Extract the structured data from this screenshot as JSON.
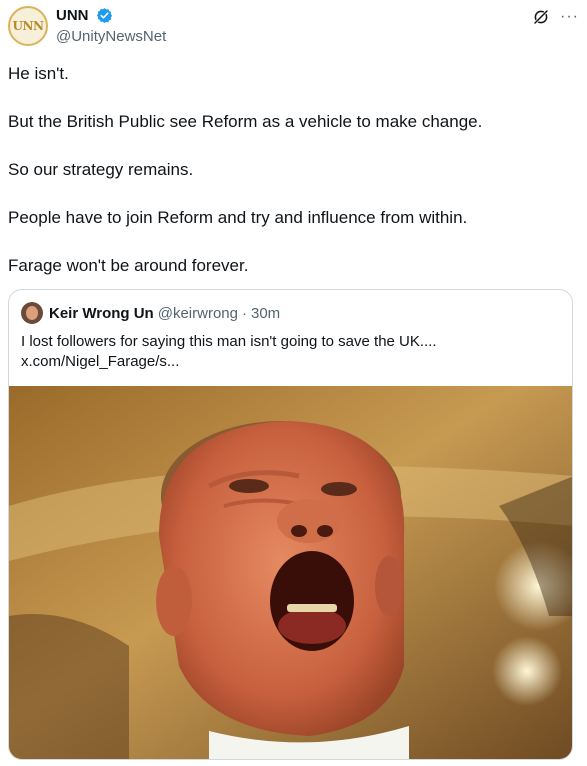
{
  "tweet": {
    "author": {
      "avatar_text": "UNN",
      "display_name": "UNN",
      "handle": "@UnityNewsNet",
      "verified": true
    },
    "icons": {
      "grok": "grok-icon",
      "more": "more-icon",
      "verified": "verified-badge-icon"
    },
    "more_label": "···",
    "paragraphs": [
      "He isn't.",
      "But the British Public see Reform as a  vehicle to make change.",
      "So our strategy remains.",
      "People have to join Reform and try and influence from within.",
      "Farage won't be around forever."
    ]
  },
  "quote": {
    "display_name": "Keir Wrong Un",
    "handle": "@keirwrong",
    "separator": "·",
    "time": "30m",
    "text_line1": "I lost followers for saying this man isn't going to save the UK....",
    "text_line2": "x.com/Nigel_Farage/s..."
  },
  "colors": {
    "text": "#0f1419",
    "secondary": "#536471",
    "verified": "#1d9bf0",
    "border": "#cfd9de",
    "avatar_gold": "#d8b45a"
  }
}
